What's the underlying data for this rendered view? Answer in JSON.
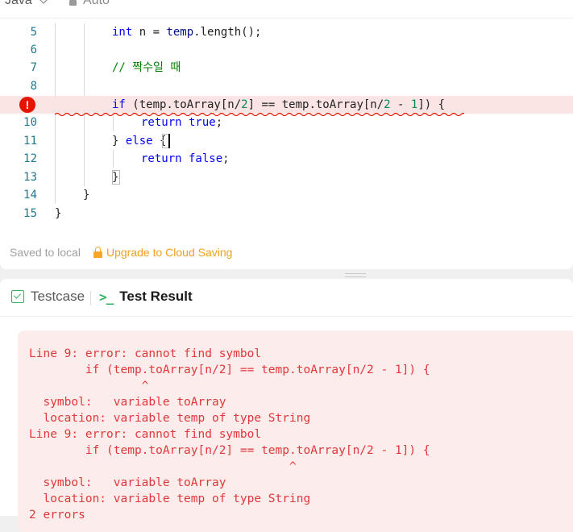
{
  "header": {
    "language": "Java",
    "mode": "Auto"
  },
  "editor": {
    "lines": [
      {
        "num": "5"
      },
      {
        "num": "6"
      },
      {
        "num": "7"
      },
      {
        "num": "8"
      },
      {
        "num": "9"
      },
      {
        "num": "10"
      },
      {
        "num": "11"
      },
      {
        "num": "12"
      },
      {
        "num": "13"
      },
      {
        "num": "14"
      },
      {
        "num": "15"
      }
    ],
    "code": {
      "l5_kw": "int",
      "l5_rest": " n = ",
      "l5_obj": "temp",
      "l5_call": ".length();",
      "l7_comment": "// 짝수일 때",
      "l9_if": "if",
      "l9_a": " (temp.toArray[n/",
      "l9_two1": "2",
      "l9_b": "] == temp.toArray[n/",
      "l9_two2": "2",
      "l9_c": " - ",
      "l9_one": "1",
      "l9_d": "]) {",
      "l10_return": "return",
      "l10_val": " true",
      "l10_end": ";",
      "l11_close": "} ",
      "l11_else": "else",
      "l11_open": " {",
      "l12_return": "return",
      "l12_val": " false",
      "l12_end": ";",
      "l13": "}",
      "l14": "}",
      "l15": "}"
    },
    "error_marker": "!"
  },
  "status": {
    "saved": "Saved to local",
    "upgrade": "Upgrade to Cloud Saving"
  },
  "tabs": {
    "testcase": "Testcase",
    "test_result": "Test Result",
    "terminal_glyph": ">_"
  },
  "result": {
    "error_text": "Line 9: error: cannot find symbol\n        if (temp.toArray[n/2] == temp.toArray[n/2 - 1]) {\n                ^\n  symbol:   variable toArray\n  location: variable temp of type String\nLine 9: error: cannot find symbol\n        if (temp.toArray[n/2] == temp.toArray[n/2 - 1]) {\n                                     ^\n  symbol:   variable toArray\n  location: variable temp of type String\n2 errors"
  },
  "colors": {
    "error_red": "#e51400",
    "error_bg": "#fdecec",
    "success_green": "#2db55d",
    "upgrade_orange": "#f0a020"
  }
}
